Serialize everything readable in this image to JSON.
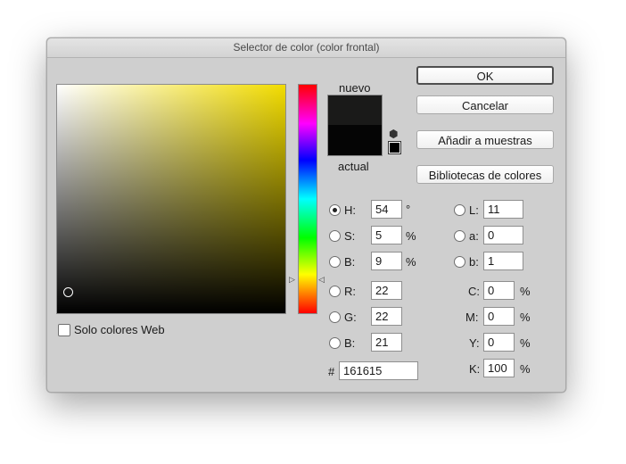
{
  "dialog": {
    "title": "Selector de color (color frontal)"
  },
  "swatches": {
    "new_label": "nuevo",
    "current_label": "actual",
    "new_color": "#1a1a19",
    "current_color": "#050505"
  },
  "buttons": {
    "ok": "OK",
    "cancel": "Cancelar",
    "add_to_swatches": "Añadir a muestras",
    "color_libraries": "Bibliotecas de colores"
  },
  "web_only": {
    "label": "Solo colores Web",
    "checked": false
  },
  "hsb": {
    "h_label": "H:",
    "h_value": "54",
    "h_unit": "°",
    "s_label": "S:",
    "s_value": "5",
    "s_unit": "%",
    "b_label": "B:",
    "b_value": "9",
    "b_unit": "%"
  },
  "rgb": {
    "r_label": "R:",
    "r_value": "22",
    "g_label": "G:",
    "g_value": "22",
    "b_label": "B:",
    "b_value": "21"
  },
  "hex": {
    "label": "#",
    "value": "161615"
  },
  "lab": {
    "l_label": "L:",
    "l_value": "11",
    "a_label": "a:",
    "a_value": "0",
    "b_label": "b:",
    "b_value": "1"
  },
  "cmyk": {
    "c_label": "C:",
    "c_value": "0",
    "c_unit": "%",
    "m_label": "M:",
    "m_value": "0",
    "m_unit": "%",
    "y_label": "Y:",
    "y_value": "0",
    "y_unit": "%",
    "k_label": "K:",
    "k_value": "100",
    "k_unit": "%"
  },
  "icons": {
    "gamut_cube": "cube-icon",
    "web_safe": "web-safe-swatch-icon",
    "slider_left": "slider-arrow-right-icon",
    "slider_right": "slider-arrow-left-icon"
  }
}
